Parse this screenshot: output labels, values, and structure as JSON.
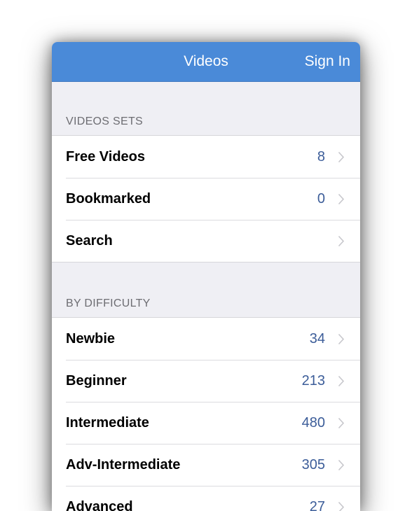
{
  "navbar": {
    "title": "Videos",
    "action_label": "Sign In"
  },
  "colors": {
    "nav_background": "#4a8ad8",
    "count_text": "#3c5d99",
    "section_header_text": "#6d6d72",
    "background": "#efeff4"
  },
  "sections": [
    {
      "header": "VIDEOS SETS",
      "rows": [
        {
          "label": "Free Videos",
          "count": "8"
        },
        {
          "label": "Bookmarked",
          "count": "0"
        },
        {
          "label": "Search",
          "count": ""
        }
      ]
    },
    {
      "header": "BY DIFFICULTY",
      "rows": [
        {
          "label": "Newbie",
          "count": "34"
        },
        {
          "label": "Beginner",
          "count": "213"
        },
        {
          "label": "Intermediate",
          "count": "480"
        },
        {
          "label": "Adv-Intermediate",
          "count": "305"
        },
        {
          "label": "Advanced",
          "count": "27"
        }
      ]
    }
  ],
  "icons": {
    "row_disclosure": "chevron-right-icon"
  }
}
